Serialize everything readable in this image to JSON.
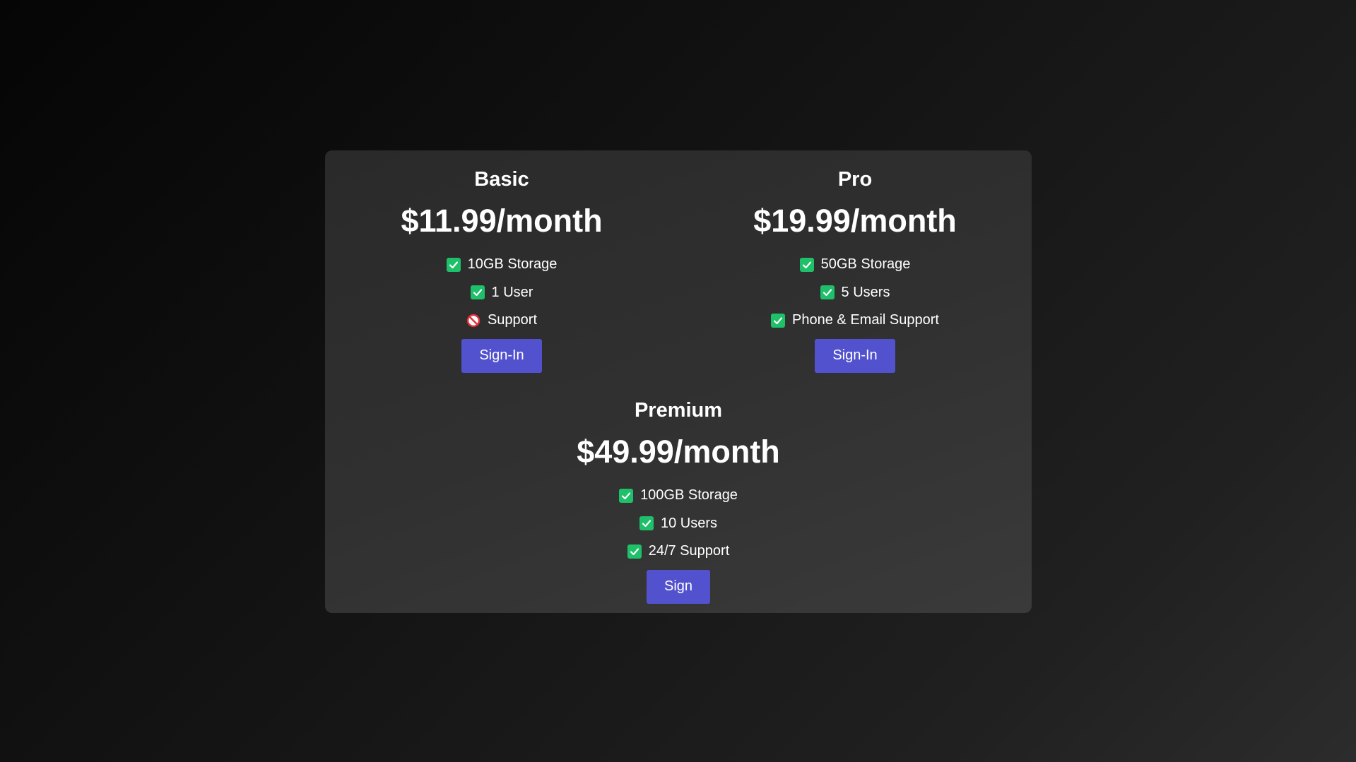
{
  "colors": {
    "accent": "#5352ce",
    "check": "#1ec06a",
    "prohibited": "#e0303a",
    "panel": "#303030",
    "text": "#ffffff"
  },
  "plans": [
    {
      "name": "Basic",
      "price": "$11.99/month",
      "features": [
        {
          "label": "10GB Storage",
          "icon": "check-icon"
        },
        {
          "label": "1 User",
          "icon": "check-icon"
        },
        {
          "label": "Support",
          "icon": "prohibited-icon"
        }
      ],
      "button_label": "Sign-In"
    },
    {
      "name": "Pro",
      "price": "$19.99/month",
      "features": [
        {
          "label": "50GB Storage",
          "icon": "check-icon"
        },
        {
          "label": "5 Users",
          "icon": "check-icon"
        },
        {
          "label": "Phone & Email Support",
          "icon": "check-icon"
        }
      ],
      "button_label": "Sign-In"
    },
    {
      "name": "Premium",
      "price": "$49.99/month",
      "features": [
        {
          "label": "100GB Storage",
          "icon": "check-icon"
        },
        {
          "label": "10 Users",
          "icon": "check-icon"
        },
        {
          "label": "24/7 Support",
          "icon": "check-icon"
        }
      ],
      "button_label": "Sign"
    }
  ]
}
